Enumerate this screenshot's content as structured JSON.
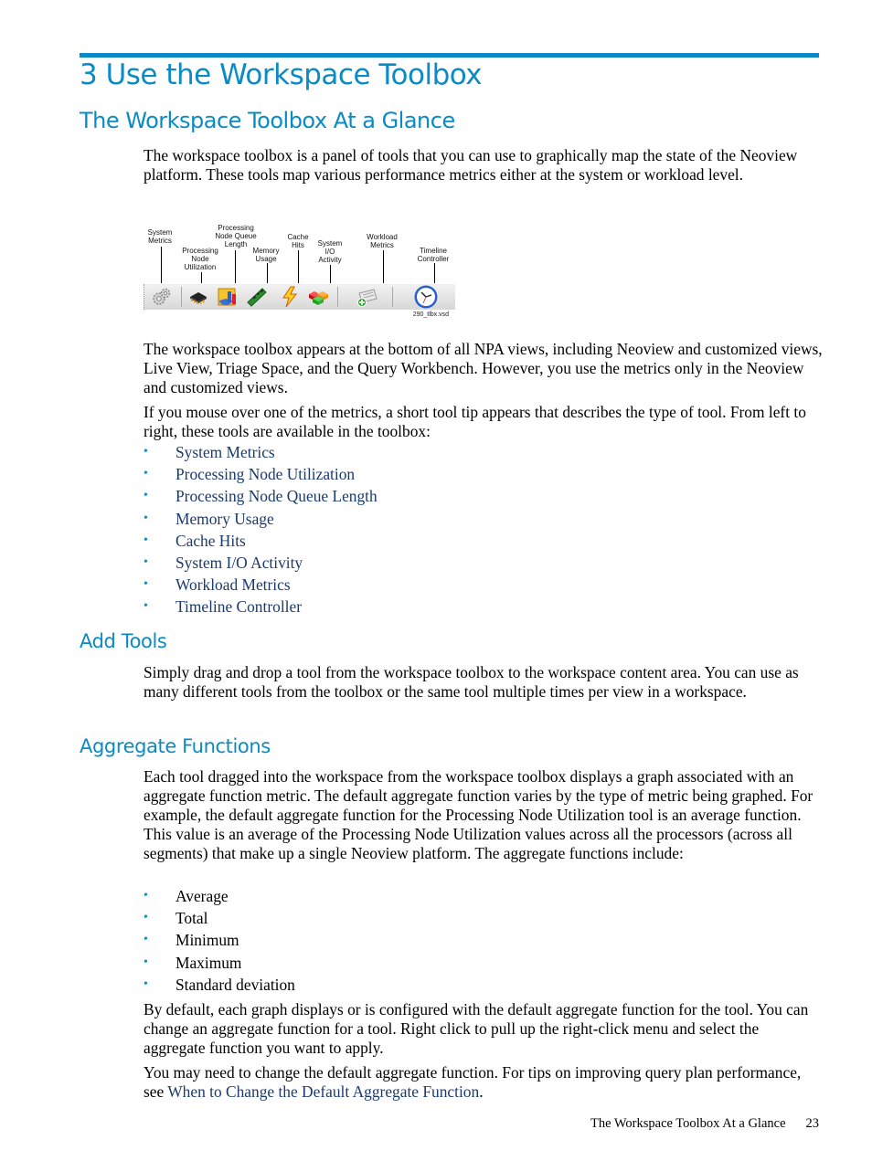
{
  "chapter_title": "3 Use the Workspace Toolbox",
  "section_title": "The Workspace Toolbox At a Glance",
  "intro_paragraph": "The workspace toolbox is a panel of tools that you can use to graphically map the state of the Neoview platform. These tools map various performance metrics either at the system or workload level.",
  "figure": {
    "labels": {
      "system_metrics": "System\nMetrics",
      "pn_utilization": "Processing\nNode\nUtilization",
      "pn_queue": "Processing\nNode Queue\nLength",
      "memory": "Memory\nUsage",
      "cache": "Cache\nHits",
      "sysio": "System\nI/O\nActivity",
      "workload": "Workload\nMetrics",
      "timeline": "Timeline\nController"
    },
    "icons": [
      "gears-icon",
      "chip-icon",
      "chart-icon",
      "memory-stick-icon",
      "lightning-icon",
      "cubes-icon",
      "workload-add-icon",
      "clock-icon"
    ],
    "filename": "290_tlbx.vsd"
  },
  "para2": "The workspace toolbox appears at the bottom of all NPA views, including Neoview and customized views, Live View, Triage Space, and the Query Workbench. However, you use the metrics only in the Neoview and customized views.",
  "para3": "If you mouse over one of the metrics, a short tool tip appears that describes the type of tool. From left to right, these tools are available in the toolbox:",
  "tools_list": [
    "System Metrics",
    "Processing Node Utilization",
    "Processing Node Queue Length",
    "Memory Usage",
    "Cache Hits",
    "System I/O Activity",
    "Workload Metrics",
    "Timeline Controller"
  ],
  "bullet": "•",
  "add_tools": {
    "title": "Add Tools",
    "paragraph": "Simply drag and drop a tool from the workspace toolbox to the workspace content area. You can use as many different tools from the toolbox or the same tool multiple times per view in a workspace."
  },
  "aggregate": {
    "title": "Aggregate Functions",
    "paragraph": "Each tool dragged into the workspace from the workspace toolbox displays a graph associated with an aggregate function metric. The default aggregate function varies by the type of metric being graphed. For example, the default aggregate function for the Processing Node Utilization tool is an average function. This value is an average of the Processing Node Utilization values across all the processors (across all segments) that make up a single Neoview platform. The aggregate functions include:",
    "functions": [
      "Average",
      "Total",
      "Minimum",
      "Maximum",
      "Standard deviation"
    ],
    "para_default": "By default, each graph displays or is configured with the default aggregate function for the tool. You can change an aggregate function for a tool. Right click to pull up the right-click menu and select the aggregate function you want to apply.",
    "para_tips_prefix": "You may need to change the default aggregate function. For tips on improving query plan performance, see ",
    "para_tips_link": "When to Change the Default Aggregate Function",
    "para_tips_suffix": "."
  },
  "footer": {
    "section": "The Workspace Toolbox At a Glance",
    "page_number": "23"
  },
  "colors": {
    "heading": "#0a8bc4",
    "link": "#1a3a6e",
    "bullet": "#0a8bc4"
  }
}
